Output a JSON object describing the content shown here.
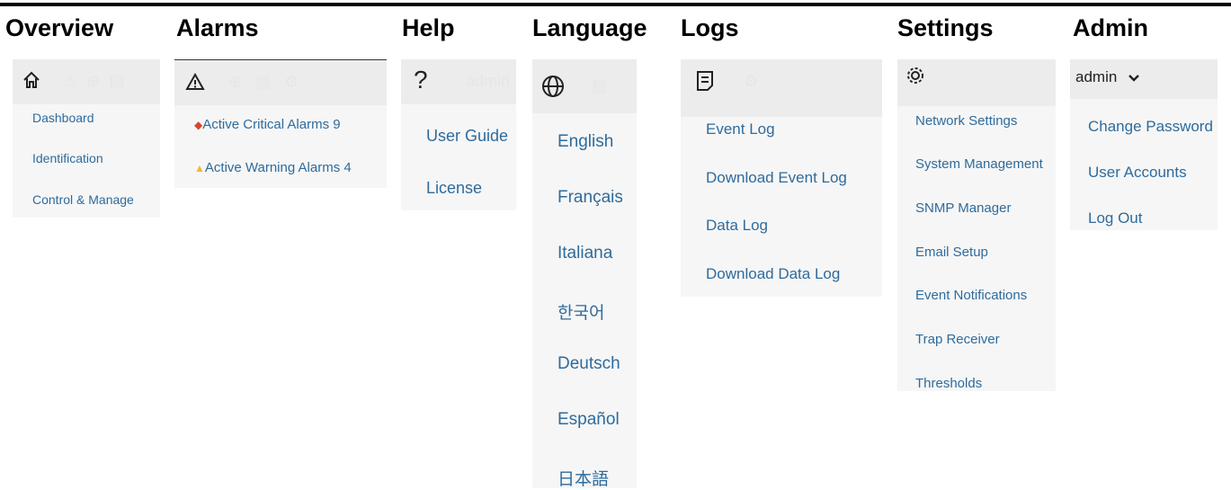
{
  "headings": {
    "overview": "Overview",
    "alarms": "Alarms",
    "help": "Help",
    "language": "Language",
    "logs": "Logs",
    "settings": "Settings",
    "admin": "Admin"
  },
  "overview_menu": {
    "icon": "home-icon",
    "items": [
      "Dashboard",
      "Identification",
      "Control & Manage"
    ]
  },
  "alarms_menu": {
    "icon": "warning-triangle-icon",
    "items": [
      {
        "marker": "◆",
        "marker_color": "#d9442b",
        "label": "Active Critical Alarms 9"
      },
      {
        "marker": "▲",
        "marker_color": "#f1b82d",
        "label": "Active Warning Alarms 4"
      }
    ]
  },
  "help_menu": {
    "icon": "question-mark-icon",
    "icon_glyph": "?",
    "items": [
      "User Guide",
      "License"
    ]
  },
  "language_menu": {
    "icon": "globe-icon",
    "items": [
      "English",
      "Français",
      "Italiana",
      "한국어",
      "Deutsch",
      "Español",
      "日本語"
    ]
  },
  "logs_menu": {
    "icon": "log-document-icon",
    "items": [
      "Event Log",
      "Download Event Log",
      "Data Log",
      "Download Data Log"
    ]
  },
  "settings_menu": {
    "icon": "gear-icon",
    "items": [
      "Network Settings",
      "System Management",
      "SNMP Manager",
      "Email Setup",
      "Event Notifications",
      "Trap Receiver",
      "Thresholds"
    ]
  },
  "admin_menu": {
    "user": "admin",
    "icon": "chevron-down-icon",
    "items": [
      "Change Password",
      "User Accounts",
      "Log Out"
    ]
  },
  "colors": {
    "link": "#2e6b9c",
    "panel": "#f6f6f6",
    "panel_header": "#ececec"
  }
}
